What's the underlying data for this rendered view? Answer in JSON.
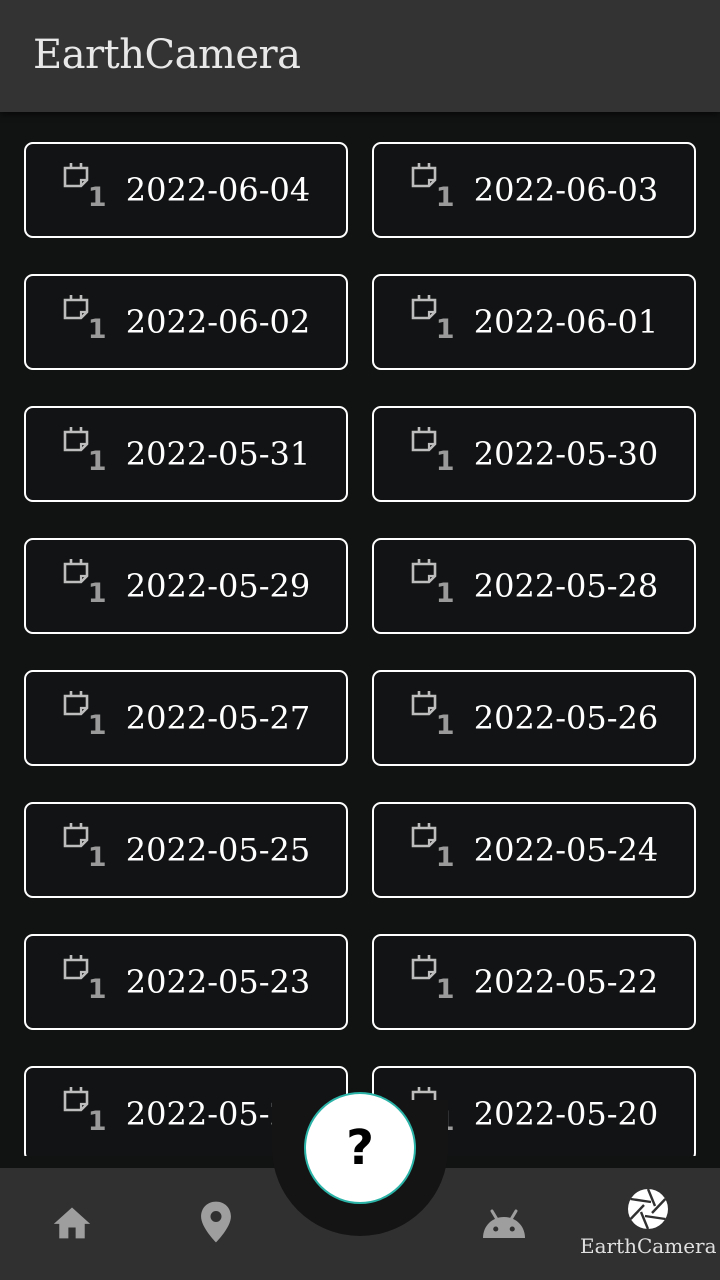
{
  "app_bar": {
    "title": "EarthCamera"
  },
  "date_cards": [
    {
      "count": "1",
      "date": "2022-06-04"
    },
    {
      "count": "1",
      "date": "2022-06-03"
    },
    {
      "count": "1",
      "date": "2022-06-02"
    },
    {
      "count": "1",
      "date": "2022-06-01"
    },
    {
      "count": "1",
      "date": "2022-05-31"
    },
    {
      "count": "1",
      "date": "2022-05-30"
    },
    {
      "count": "1",
      "date": "2022-05-29"
    },
    {
      "count": "1",
      "date": "2022-05-28"
    },
    {
      "count": "1",
      "date": "2022-05-27"
    },
    {
      "count": "1",
      "date": "2022-05-26"
    },
    {
      "count": "1",
      "date": "2022-05-25"
    },
    {
      "count": "1",
      "date": "2022-05-24"
    },
    {
      "count": "1",
      "date": "2022-05-23"
    },
    {
      "count": "1",
      "date": "2022-05-22"
    },
    {
      "count": "1",
      "date": "2022-05-21"
    },
    {
      "count": "1",
      "date": "2022-05-20"
    }
  ],
  "fab": {
    "label": "?"
  },
  "bottom_nav": {
    "items": [
      {
        "icon": "home-icon"
      },
      {
        "icon": "location-pin-icon"
      },
      {
        "icon": "android-icon"
      },
      {
        "icon": "camera-aperture-icon",
        "label": "EarthCamera",
        "active": true
      }
    ]
  },
  "colors": {
    "background": "#111212",
    "app_bar": "#333333",
    "card_border": "#ffffff",
    "count_text": "#9a9a9a",
    "fab_border": "#2bb3a8",
    "nav_icon": "#9e9e9e"
  }
}
